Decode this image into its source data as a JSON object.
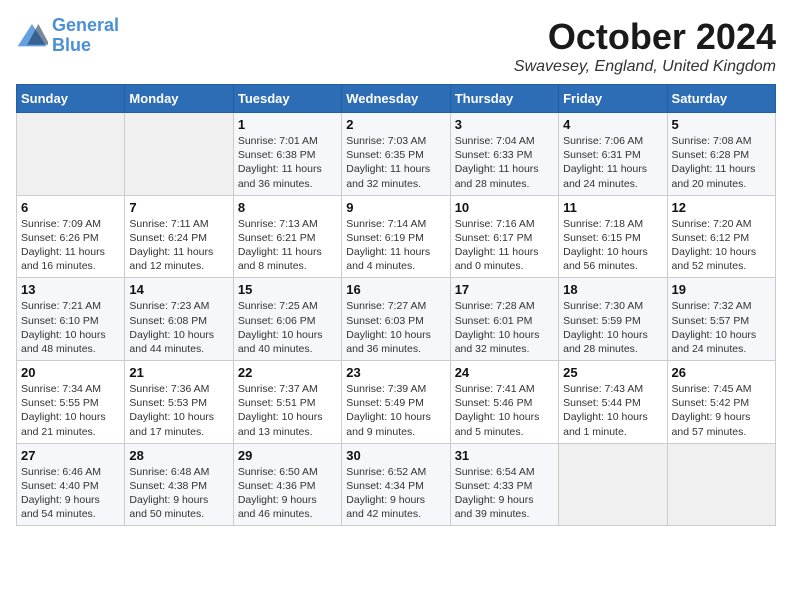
{
  "logo": {
    "line1": "General",
    "line2": "Blue"
  },
  "title": "October 2024",
  "location": "Swavesey, England, United Kingdom",
  "days_of_week": [
    "Sunday",
    "Monday",
    "Tuesday",
    "Wednesday",
    "Thursday",
    "Friday",
    "Saturday"
  ],
  "weeks": [
    [
      {
        "num": "",
        "info": ""
      },
      {
        "num": "",
        "info": ""
      },
      {
        "num": "1",
        "info": "Sunrise: 7:01 AM\nSunset: 6:38 PM\nDaylight: 11 hours\nand 36 minutes."
      },
      {
        "num": "2",
        "info": "Sunrise: 7:03 AM\nSunset: 6:35 PM\nDaylight: 11 hours\nand 32 minutes."
      },
      {
        "num": "3",
        "info": "Sunrise: 7:04 AM\nSunset: 6:33 PM\nDaylight: 11 hours\nand 28 minutes."
      },
      {
        "num": "4",
        "info": "Sunrise: 7:06 AM\nSunset: 6:31 PM\nDaylight: 11 hours\nand 24 minutes."
      },
      {
        "num": "5",
        "info": "Sunrise: 7:08 AM\nSunset: 6:28 PM\nDaylight: 11 hours\nand 20 minutes."
      }
    ],
    [
      {
        "num": "6",
        "info": "Sunrise: 7:09 AM\nSunset: 6:26 PM\nDaylight: 11 hours\nand 16 minutes."
      },
      {
        "num": "7",
        "info": "Sunrise: 7:11 AM\nSunset: 6:24 PM\nDaylight: 11 hours\nand 12 minutes."
      },
      {
        "num": "8",
        "info": "Sunrise: 7:13 AM\nSunset: 6:21 PM\nDaylight: 11 hours\nand 8 minutes."
      },
      {
        "num": "9",
        "info": "Sunrise: 7:14 AM\nSunset: 6:19 PM\nDaylight: 11 hours\nand 4 minutes."
      },
      {
        "num": "10",
        "info": "Sunrise: 7:16 AM\nSunset: 6:17 PM\nDaylight: 11 hours\nand 0 minutes."
      },
      {
        "num": "11",
        "info": "Sunrise: 7:18 AM\nSunset: 6:15 PM\nDaylight: 10 hours\nand 56 minutes."
      },
      {
        "num": "12",
        "info": "Sunrise: 7:20 AM\nSunset: 6:12 PM\nDaylight: 10 hours\nand 52 minutes."
      }
    ],
    [
      {
        "num": "13",
        "info": "Sunrise: 7:21 AM\nSunset: 6:10 PM\nDaylight: 10 hours\nand 48 minutes."
      },
      {
        "num": "14",
        "info": "Sunrise: 7:23 AM\nSunset: 6:08 PM\nDaylight: 10 hours\nand 44 minutes."
      },
      {
        "num": "15",
        "info": "Sunrise: 7:25 AM\nSunset: 6:06 PM\nDaylight: 10 hours\nand 40 minutes."
      },
      {
        "num": "16",
        "info": "Sunrise: 7:27 AM\nSunset: 6:03 PM\nDaylight: 10 hours\nand 36 minutes."
      },
      {
        "num": "17",
        "info": "Sunrise: 7:28 AM\nSunset: 6:01 PM\nDaylight: 10 hours\nand 32 minutes."
      },
      {
        "num": "18",
        "info": "Sunrise: 7:30 AM\nSunset: 5:59 PM\nDaylight: 10 hours\nand 28 minutes."
      },
      {
        "num": "19",
        "info": "Sunrise: 7:32 AM\nSunset: 5:57 PM\nDaylight: 10 hours\nand 24 minutes."
      }
    ],
    [
      {
        "num": "20",
        "info": "Sunrise: 7:34 AM\nSunset: 5:55 PM\nDaylight: 10 hours\nand 21 minutes."
      },
      {
        "num": "21",
        "info": "Sunrise: 7:36 AM\nSunset: 5:53 PM\nDaylight: 10 hours\nand 17 minutes."
      },
      {
        "num": "22",
        "info": "Sunrise: 7:37 AM\nSunset: 5:51 PM\nDaylight: 10 hours\nand 13 minutes."
      },
      {
        "num": "23",
        "info": "Sunrise: 7:39 AM\nSunset: 5:49 PM\nDaylight: 10 hours\nand 9 minutes."
      },
      {
        "num": "24",
        "info": "Sunrise: 7:41 AM\nSunset: 5:46 PM\nDaylight: 10 hours\nand 5 minutes."
      },
      {
        "num": "25",
        "info": "Sunrise: 7:43 AM\nSunset: 5:44 PM\nDaylight: 10 hours\nand 1 minute."
      },
      {
        "num": "26",
        "info": "Sunrise: 7:45 AM\nSunset: 5:42 PM\nDaylight: 9 hours\nand 57 minutes."
      }
    ],
    [
      {
        "num": "27",
        "info": "Sunrise: 6:46 AM\nSunset: 4:40 PM\nDaylight: 9 hours\nand 54 minutes."
      },
      {
        "num": "28",
        "info": "Sunrise: 6:48 AM\nSunset: 4:38 PM\nDaylight: 9 hours\nand 50 minutes."
      },
      {
        "num": "29",
        "info": "Sunrise: 6:50 AM\nSunset: 4:36 PM\nDaylight: 9 hours\nand 46 minutes."
      },
      {
        "num": "30",
        "info": "Sunrise: 6:52 AM\nSunset: 4:34 PM\nDaylight: 9 hours\nand 42 minutes."
      },
      {
        "num": "31",
        "info": "Sunrise: 6:54 AM\nSunset: 4:33 PM\nDaylight: 9 hours\nand 39 minutes."
      },
      {
        "num": "",
        "info": ""
      },
      {
        "num": "",
        "info": ""
      }
    ]
  ]
}
